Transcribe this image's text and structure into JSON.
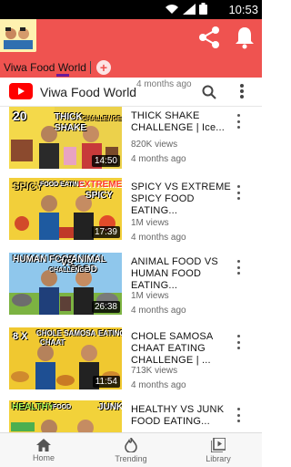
{
  "status": {
    "time": "10:53"
  },
  "header": {
    "colors": {
      "bar": "#ef5350",
      "accent": "#6a1b9a"
    },
    "tab_label": "Viwa Food World",
    "add_icon": "plus-icon",
    "share_icon": "share-icon",
    "bell_icon": "bell-icon"
  },
  "yt_bar": {
    "channel_name": "Viwa Food World",
    "peek_meta": "4 months ago"
  },
  "videos": [
    {
      "title": "THICK SHAKE CHALLENGE | Ice...",
      "views": "820K views",
      "ago": "4 months ago",
      "duration": "14:50",
      "thumb_text": [
        "20",
        "THICK",
        "SHAKE",
        "CHALLENGE"
      ]
    },
    {
      "title": "SPICY VS EXTREME SPICY FOOD EATING...",
      "views": "1M views",
      "ago": "4 months ago",
      "duration": "17:39",
      "thumb_text": [
        "SPICY",
        "FOOD EATING",
        "EXTREME",
        "SPICY"
      ]
    },
    {
      "title": "ANIMAL FOOD VS HUMAN FOOD EATING...",
      "views": "1M views",
      "ago": "4 months ago",
      "duration": "26:38",
      "thumb_text": [
        "HUMAN FOOD",
        "VS",
        "ANIMAL FOOD",
        "CHALLENGE"
      ]
    },
    {
      "title": "CHOLE SAMOSA CHAAT EATING CHALLENGE | ...",
      "views": "713K views",
      "ago": "4 months ago",
      "duration": "11:54",
      "thumb_text": [
        "8 X",
        "CHOLE SAMOSA",
        "CHAAT",
        "EATING"
      ]
    },
    {
      "title": "HEALTHY VS JUNK FOOD EATING...",
      "views": "",
      "ago": "",
      "duration": "",
      "thumb_text": [
        "HEALTHY",
        "FOOD",
        "JUNK"
      ]
    }
  ],
  "bottom_nav": [
    {
      "label": "Home",
      "icon": "home-icon"
    },
    {
      "label": "Trending",
      "icon": "flame-icon"
    },
    {
      "label": "Library",
      "icon": "library-icon"
    }
  ]
}
